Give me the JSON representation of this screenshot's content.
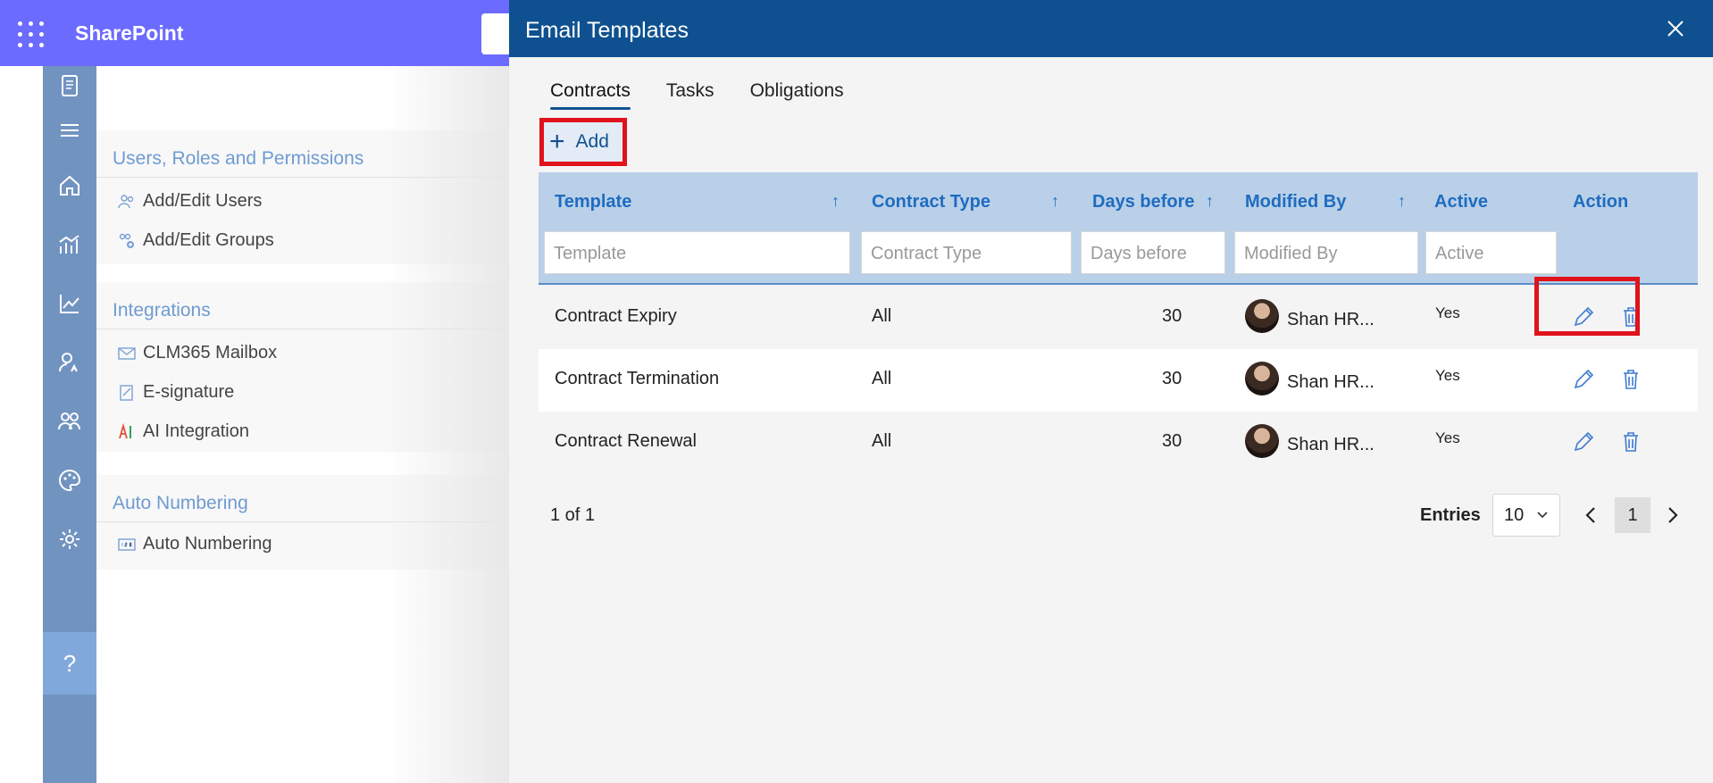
{
  "suitebar": {
    "app_name": "SharePoint"
  },
  "menu": {
    "groups": [
      {
        "title": "Users, Roles and Permissions",
        "items": [
          "Add/Edit Users",
          "Add/Edit Groups"
        ]
      },
      {
        "title": "Integrations",
        "items": [
          "CLM365 Mailbox",
          "E-signature",
          "AI Integration"
        ]
      },
      {
        "title": "Auto Numbering",
        "items": [
          "Auto Numbering"
        ]
      }
    ]
  },
  "rail": {
    "help": "?"
  },
  "panel": {
    "title": "Email Templates",
    "tabs": [
      "Contracts",
      "Tasks",
      "Obligations"
    ],
    "active_tab": "Contracts",
    "add_label": "Add",
    "columns": {
      "template": "Template",
      "contract_type": "Contract Type",
      "days_before": "Days before",
      "modified_by": "Modified By",
      "active": "Active",
      "action": "Action"
    },
    "filters": {
      "template": "Template",
      "contract_type": "Contract Type",
      "days_before": "Days before",
      "modified_by": "Modified By",
      "active": "Active"
    },
    "rows": [
      {
        "template": "Contract Expiry",
        "contract_type": "All",
        "days_before": "30",
        "modified_by": "Shan HR...",
        "active": "Yes"
      },
      {
        "template": "Contract Termination",
        "contract_type": "All",
        "days_before": "30",
        "modified_by": "Shan HR...",
        "active": "Yes"
      },
      {
        "template": "Contract Renewal",
        "contract_type": "All",
        "days_before": "30",
        "modified_by": "Shan HR...",
        "active": "Yes"
      }
    ],
    "pager": {
      "summary": "1 of 1",
      "entries_label": "Entries",
      "entries_value": "10",
      "current_page": "1"
    }
  },
  "colors": {
    "suitebar": "#6b6bff",
    "panel_header": "#0f5190",
    "rail": "#7193c0",
    "highlight": "#e0121b",
    "grid_header": "#b9d0e8"
  }
}
